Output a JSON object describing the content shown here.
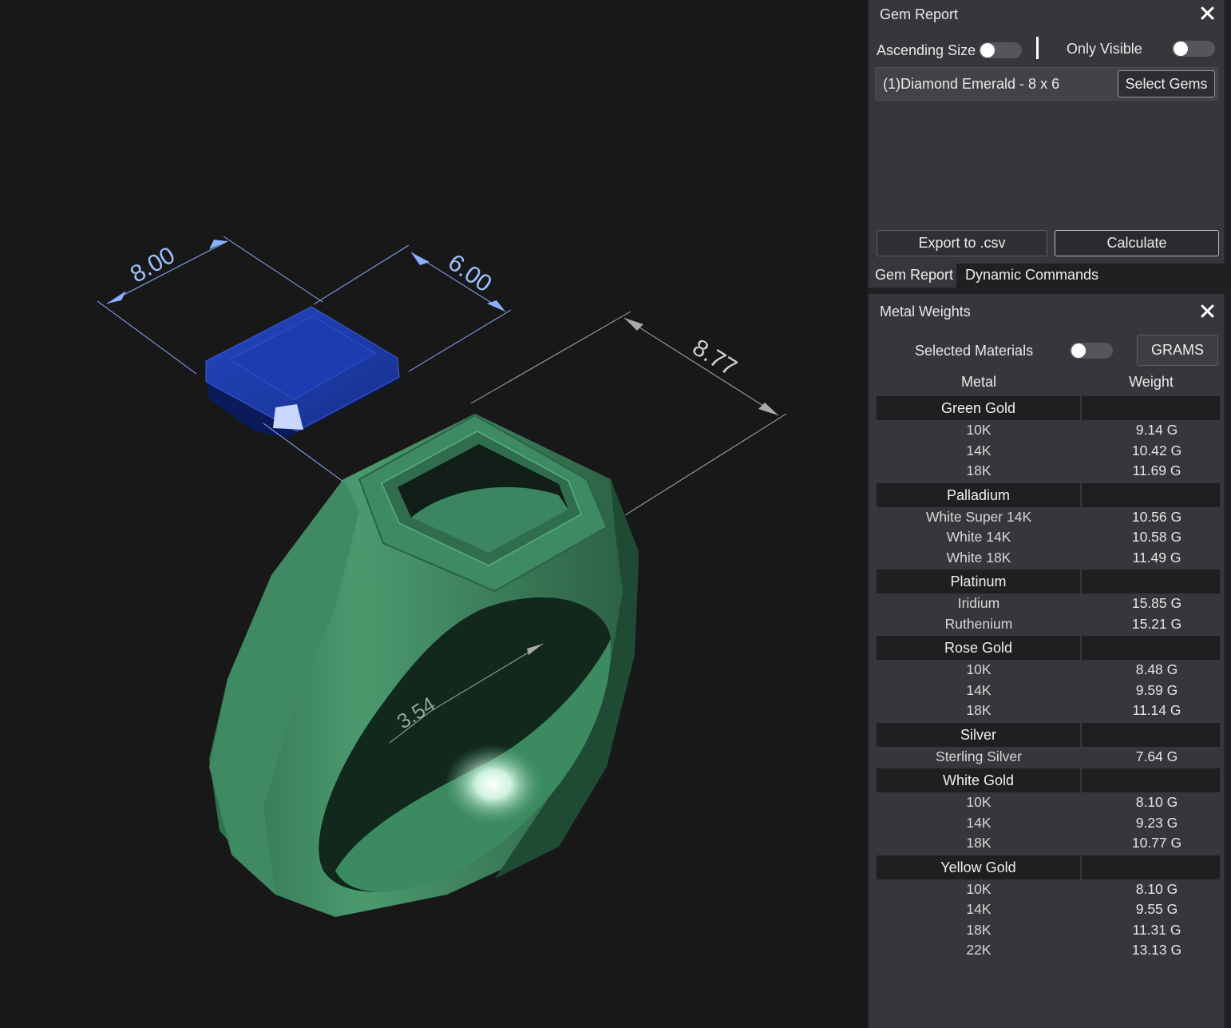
{
  "viewport": {
    "dimensions": [
      "8.00",
      "6.00",
      "8.77",
      "3.54"
    ],
    "colors": {
      "background": "#181818",
      "gem": "#1a3aa8",
      "ring": "#4a9a6e",
      "dimension_line": "#8ab0ff",
      "measure_line": "#bbbbbb"
    }
  },
  "gem_report": {
    "title": "Gem Report",
    "ascending_size_label": "Ascending Size",
    "ascending_size_on": false,
    "only_visible_label": "Only Visible",
    "only_visible_on": false,
    "gem_item": "(1)Diamond Emerald - 8 x 6",
    "select_gems_label": "Select Gems",
    "export_label": "Export to .csv",
    "calculate_label": "Calculate",
    "close_icon": "close-icon"
  },
  "tabs": [
    "Gem Report",
    "Dynamic Commands"
  ],
  "metal_weights": {
    "title": "Metal Weights",
    "selected_materials_label": "Selected Materials",
    "selected_materials_on": false,
    "units_label": "GRAMS",
    "columns": [
      "Metal",
      "Weight"
    ],
    "groups": [
      {
        "name": "Green Gold",
        "rows": [
          {
            "metal": "10K",
            "weight": "9.14 G"
          },
          {
            "metal": "14K",
            "weight": "10.42 G"
          },
          {
            "metal": "18K",
            "weight": "11.69 G"
          }
        ]
      },
      {
        "name": "Palladium",
        "rows": [
          {
            "metal": "White Super 14K",
            "weight": "10.56 G"
          },
          {
            "metal": "White 14K",
            "weight": "10.58 G"
          },
          {
            "metal": "White 18K",
            "weight": "11.49 G"
          }
        ]
      },
      {
        "name": "Platinum",
        "rows": [
          {
            "metal": "Iridium",
            "weight": "15.85 G"
          },
          {
            "metal": "Ruthenium",
            "weight": "15.21 G"
          }
        ]
      },
      {
        "name": "Rose Gold",
        "rows": [
          {
            "metal": "10K",
            "weight": "8.48 G"
          },
          {
            "metal": "14K",
            "weight": "9.59 G"
          },
          {
            "metal": "18K",
            "weight": "11.14 G"
          }
        ]
      },
      {
        "name": "Silver",
        "rows": [
          {
            "metal": "Sterling Silver",
            "weight": "7.64 G"
          }
        ]
      },
      {
        "name": "White Gold",
        "rows": [
          {
            "metal": "10K",
            "weight": "8.10 G"
          },
          {
            "metal": "14K",
            "weight": "9.23 G"
          },
          {
            "metal": "18K",
            "weight": "10.77 G"
          }
        ]
      },
      {
        "name": "Yellow Gold",
        "rows": [
          {
            "metal": "10K",
            "weight": "8.10 G"
          },
          {
            "metal": "14K",
            "weight": "9.55 G"
          },
          {
            "metal": "18K",
            "weight": "11.31 G"
          },
          {
            "metal": "22K",
            "weight": "13.13 G"
          }
        ]
      }
    ]
  }
}
